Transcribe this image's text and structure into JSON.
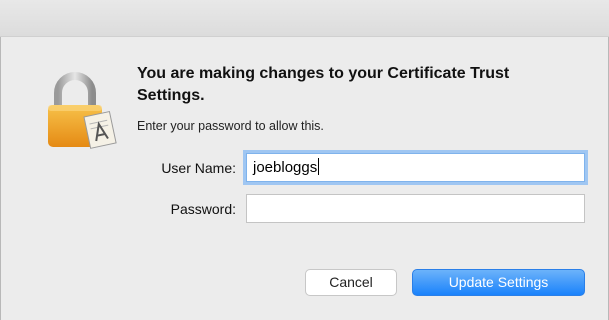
{
  "dialog": {
    "heading": "You are making changes to your Certificate Trust Settings.",
    "subtext": "Enter your password to allow this.",
    "icon": "lock-icon"
  },
  "fields": {
    "username_label": "User Name:",
    "username_value": "joebloggs",
    "password_label": "Password:",
    "password_value": ""
  },
  "buttons": {
    "cancel_label": "Cancel",
    "update_label": "Update Settings"
  },
  "colors": {
    "accent": "#1a82fb",
    "lock_body": "#f0a21f",
    "focus_ring": "#9fc6f2"
  }
}
